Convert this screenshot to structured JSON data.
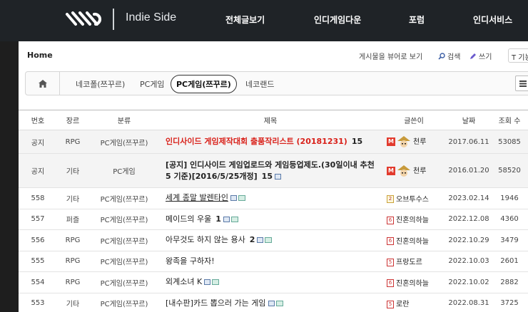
{
  "header": {
    "brand": "Indie Side",
    "nav": [
      "전체글보기",
      "인디게임다운",
      "포럼",
      "인디서비스"
    ]
  },
  "toolbar": {
    "home": "Home",
    "viewer": "게시물을 뷰어로 보기",
    "search": "검색",
    "write": "쓰기",
    "tool": "T 기능"
  },
  "categories": {
    "tabs": [
      "네코폴(쯔꾸르)",
      "PC게임",
      "PC게임(쯔꾸르)",
      "네코랜드"
    ],
    "active_index": 2
  },
  "table": {
    "headers": [
      "번호",
      "장르",
      "분류",
      "제목",
      "글쓴이",
      "날짜",
      "조회 수"
    ],
    "rows": [
      {
        "no": "공지",
        "genre": "RPG",
        "cat": "PC게임(쯔꾸르)",
        "title": "인디사이드 게임제작대회 출품작리스트 (20181231)",
        "count": "15",
        "author": "천루",
        "date": "2017.06.11",
        "views": "53085"
      },
      {
        "no": "공지",
        "genre": "기타",
        "cat": "PC게임",
        "title": "[공지] 인디사이드 게임업로드와 게임등업제도.(30일이내 추천 5 기준)[2016/5/25개정]",
        "count": "15",
        "author": "천루",
        "date": "2016.01.20",
        "views": "58520"
      },
      {
        "no": "558",
        "genre": "기타",
        "cat": "PC게임(쯔꾸르)",
        "title": "세계 종말 발렌타인",
        "count": "",
        "author": "오브투수스",
        "date": "2023.02.14",
        "views": "1946"
      },
      {
        "no": "557",
        "genre": "퍼즐",
        "cat": "PC게임(쯔꾸르)",
        "title": "메이드의 우울",
        "count": "1",
        "author": "진혼의하늘",
        "date": "2022.12.08",
        "views": "4360"
      },
      {
        "no": "556",
        "genre": "RPG",
        "cat": "PC게임(쯔꾸르)",
        "title": "아무것도 하지 않는 용사",
        "count": "2",
        "author": "진혼의하늘",
        "date": "2022.10.29",
        "views": "3479"
      },
      {
        "no": "555",
        "genre": "RPG",
        "cat": "PC게임(쯔꾸르)",
        "title": "왕족을 구하자!",
        "count": "",
        "author": "프랑도르",
        "date": "2022.10.03",
        "views": "2601"
      },
      {
        "no": "554",
        "genre": "RPG",
        "cat": "PC게임(쯔꾸르)",
        "title": "외계소녀 K",
        "count": "",
        "author": "진혼의하늘",
        "date": "2022.10.02",
        "views": "2882"
      },
      {
        "no": "553",
        "genre": "기타",
        "cat": "PC게임(쯔꾸르)",
        "title": "[내수판]카드 뽑으러 가는 게임",
        "count": "",
        "author": "로란",
        "date": "2022.08.31",
        "views": "3725"
      }
    ]
  },
  "colors": {
    "topbar": "#1f2327",
    "notice_title": "#d9211a",
    "admin_badge": "#e23b2e"
  }
}
